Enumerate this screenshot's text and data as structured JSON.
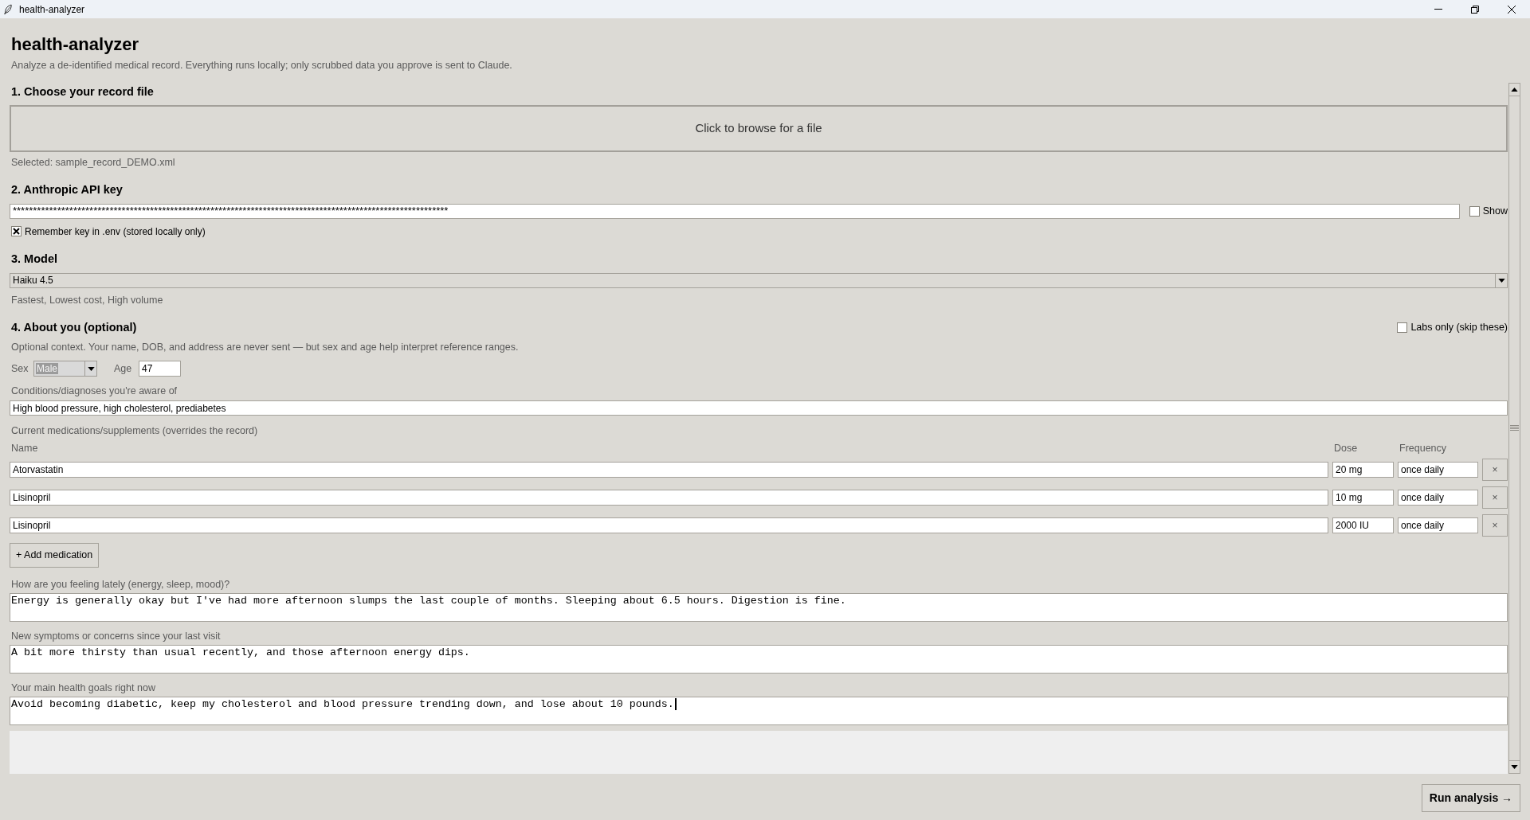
{
  "window": {
    "title": "health-analyzer"
  },
  "header": {
    "title": "health-analyzer",
    "subtitle": "Analyze a de-identified medical record. Everything runs locally; only scrubbed data you approve is sent to Claude."
  },
  "record_file": {
    "heading": "1. Choose your record file",
    "browse_button": "Click to browse for a file",
    "selected": "Selected: sample_record_DEMO.xml"
  },
  "api_key": {
    "heading": "2. Anthropic API key",
    "value": "************************************************************************************************************",
    "show": {
      "label": "Show",
      "checked": false
    },
    "remember": {
      "label": "Remember key in .env (stored locally only)",
      "checked": true
    }
  },
  "model": {
    "heading": "3. Model",
    "selected": "Haiku 4.5",
    "description": "Fastest, Lowest cost, High volume"
  },
  "about": {
    "heading": "4. About you (optional)",
    "labs_only": {
      "label": "Labs only (skip these)",
      "checked": false
    },
    "note": "Optional context. Your name, DOB, and address are never sent — but sex and age help interpret reference ranges.",
    "sex": {
      "label": "Sex",
      "value": "Male",
      "text_selected": true
    },
    "age": {
      "label": "Age",
      "value": "47"
    },
    "conditions": {
      "label": "Conditions/diagnoses you're aware of",
      "value": "High blood pressure, high cholesterol, prediabetes"
    }
  },
  "medications": {
    "label": "Current medications/supplements (overrides the record)",
    "columns": [
      "Name",
      "Dose",
      "Frequency"
    ],
    "rows": [
      {
        "name": "Atorvastatin",
        "dose": "20 mg",
        "frequency": "once daily",
        "remove": "×"
      },
      {
        "name": "Lisinopril",
        "dose": "10 mg",
        "frequency": "once daily",
        "remove": "×"
      },
      {
        "name": "Lisinopril",
        "dose": "2000 IU",
        "frequency": "once daily",
        "remove": "×"
      }
    ],
    "add_button": "+ Add medication"
  },
  "questions": [
    {
      "label": "How are you feeling lately (energy, sleep, mood)?",
      "value": "Energy is generally okay but I've had more afternoon slumps the last couple of months. Sleeping about 6.5 hours. Digestion is fine.",
      "focused": false
    },
    {
      "label": "New symptoms or concerns since your last visit",
      "value": "A bit more thirsty than usual recently, and those afternoon energy dips.",
      "focused": false
    },
    {
      "label": "Your main health goals right now",
      "value": "Avoid becoming diabetic, keep my cholesterol and blood pressure trending down, and lose about 10 pounds.",
      "focused": true
    }
  ],
  "run_button": "Run analysis →"
}
